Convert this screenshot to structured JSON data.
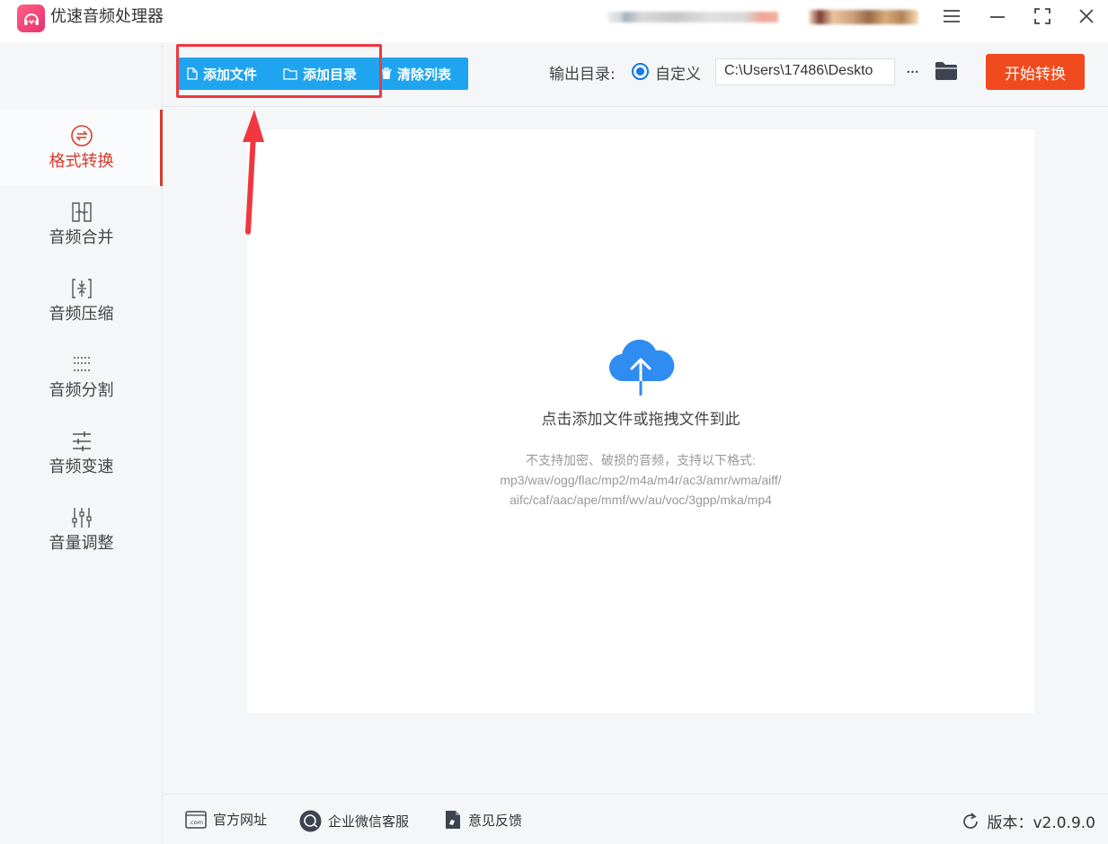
{
  "app": {
    "title": "优速音频处理器"
  },
  "sidebar": {
    "items": [
      {
        "label": "格式转换",
        "icon": "convert-icon",
        "active": true
      },
      {
        "label": "音频合并",
        "icon": "merge-icon"
      },
      {
        "label": "音频压缩",
        "icon": "compress-icon"
      },
      {
        "label": "音频分割",
        "icon": "split-icon"
      },
      {
        "label": "音频变速",
        "icon": "speed-icon"
      },
      {
        "label": "音量调整",
        "icon": "volume-icon"
      }
    ]
  },
  "toolbar": {
    "add_file": "添加文件",
    "add_folder": "添加目录",
    "clear_list": "清除列表",
    "output_label": "输出目录:",
    "radio_custom": "自定义",
    "output_path": "C:\\Users\\17486\\Deskto",
    "more": "···",
    "start": "开始转换"
  },
  "dropzone": {
    "main": "点击添加文件或拖拽文件到此",
    "hint1": "不支持加密、破损的音频，支持以下格式:",
    "hint2": "mp3/wav/ogg/flac/mp2/m4a/m4r/ac3/amr/wma/aiff/",
    "hint3": "aifc/caf/aac/ape/mmf/wv/au/voc/3gpp/mka/mp4"
  },
  "footer": {
    "website": "官方网址",
    "wechat": "企业微信客服",
    "feedback": "意见反馈",
    "version": "版本：v2.0.9.0"
  },
  "colors": {
    "accent_blue": "#1fa5ef",
    "start_red": "#f04a1e",
    "active_red": "#d83a2d",
    "highlight": "#f0373f"
  }
}
